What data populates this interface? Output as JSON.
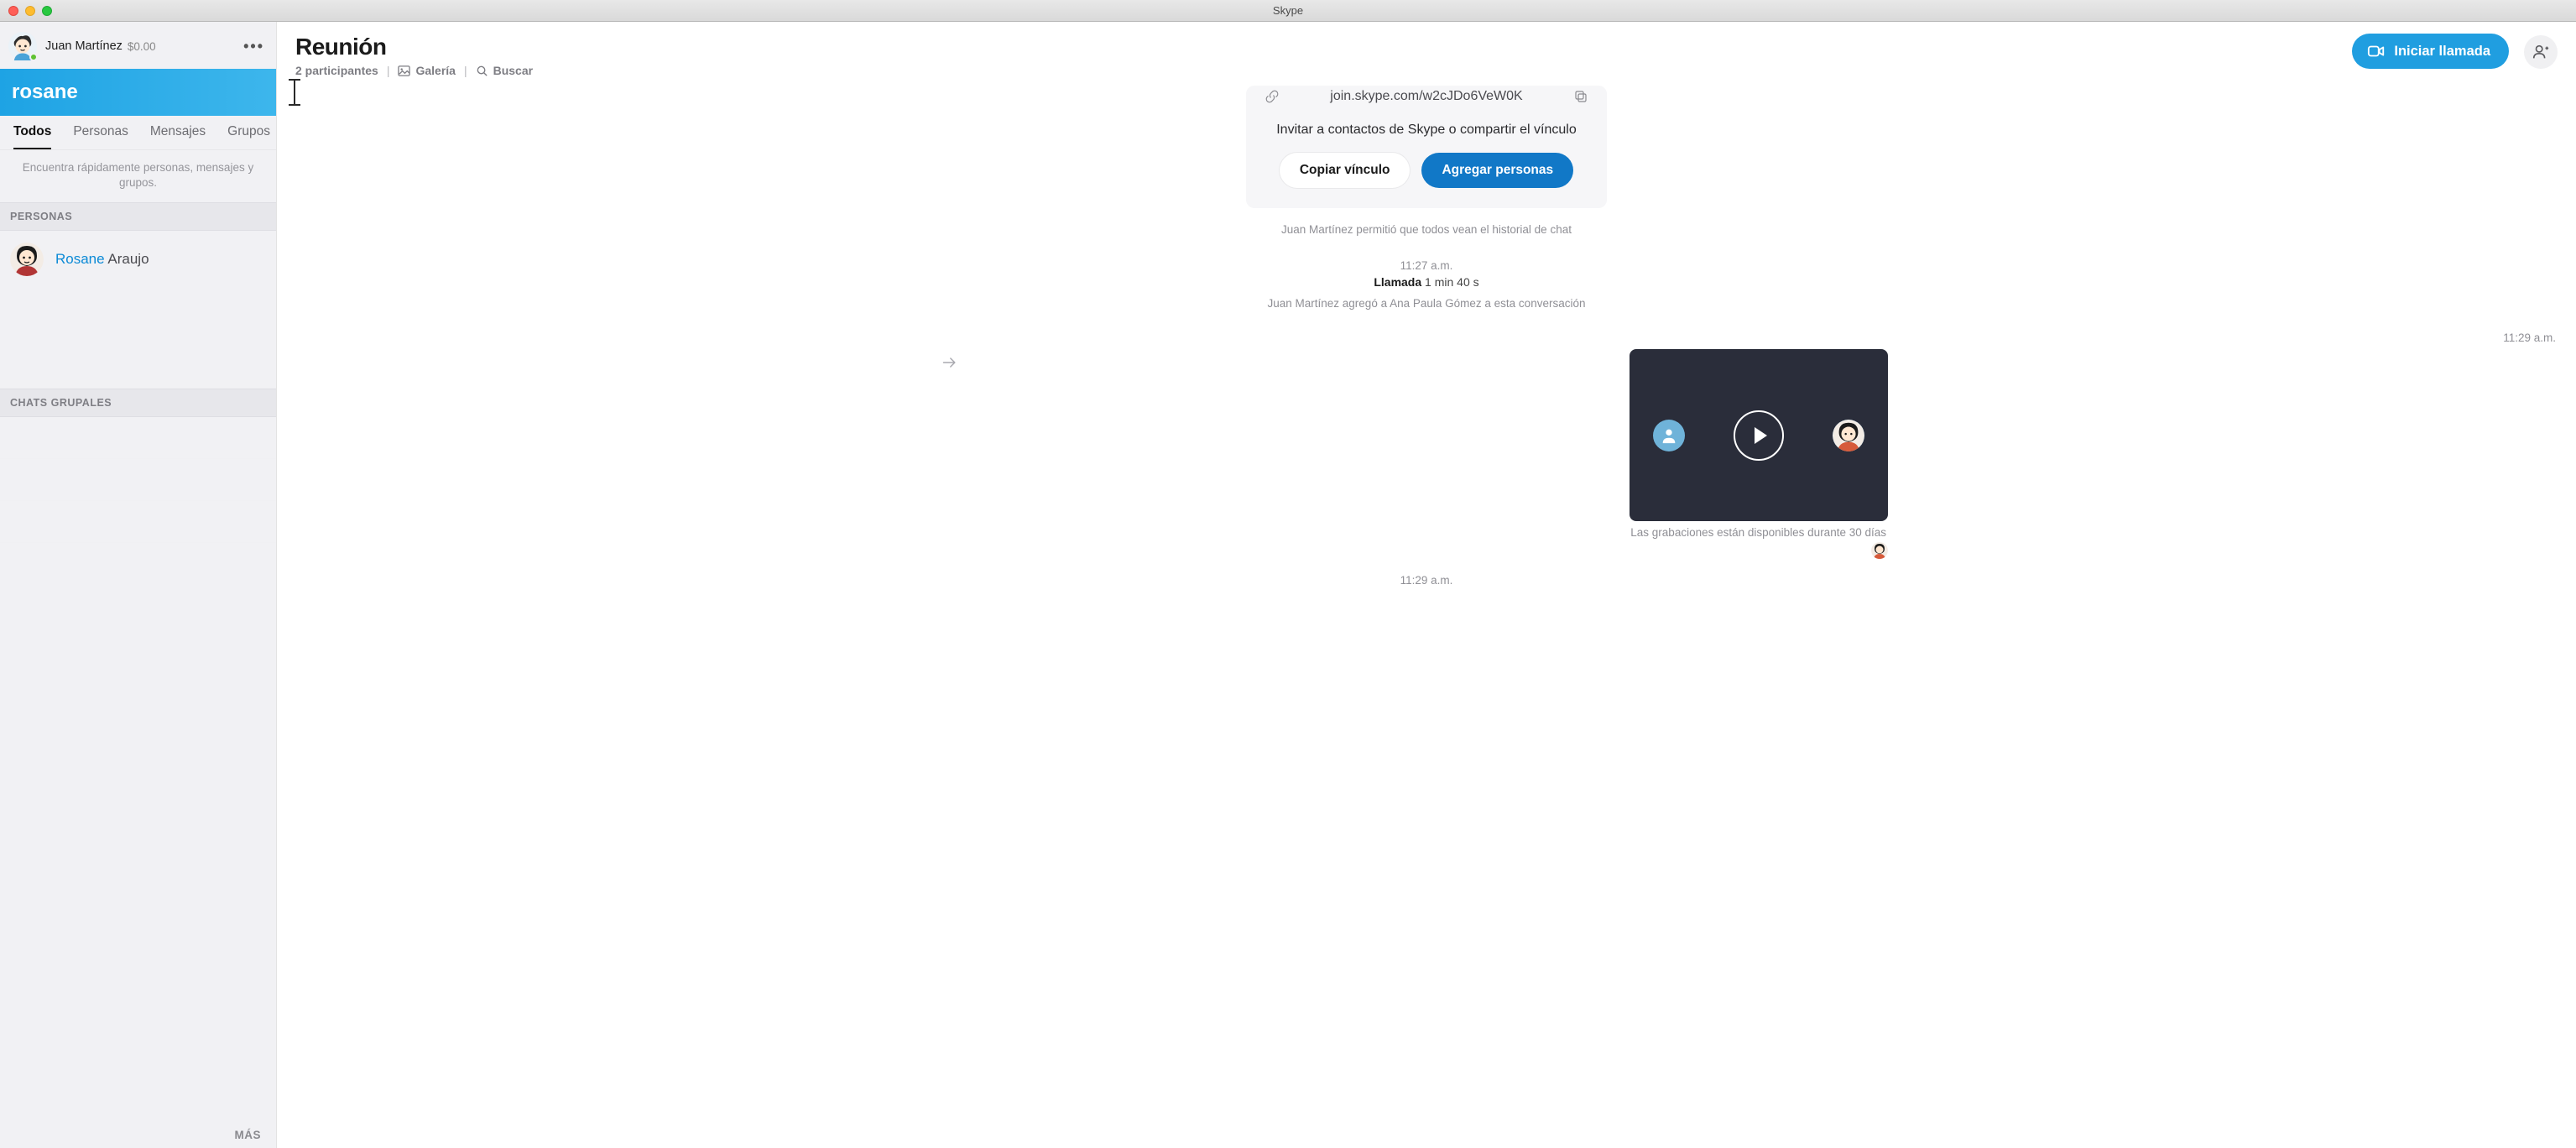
{
  "window": {
    "title": "Skype"
  },
  "profile": {
    "name": "Juan Martínez",
    "balance": "$0.00"
  },
  "search": {
    "value": "rosane",
    "clear_aria": "Clear"
  },
  "tabs": {
    "items": [
      "Todos",
      "Personas",
      "Mensajes",
      "Grupos"
    ],
    "active": 0,
    "hint": "Encuentra rápidamente personas, mensajes y grupos."
  },
  "sections": {
    "people_header": "PERSONAS",
    "groups_header": "CHATS GRUPALES",
    "more": "MÁS"
  },
  "results": {
    "people": [
      {
        "highlight": "Rosane",
        "rest": " Araujo"
      }
    ]
  },
  "chat": {
    "title": "Reunión",
    "participants_label": "2 participantes",
    "gallery_label": "Galería",
    "search_label": "Buscar",
    "call_button": "Iniciar llamada"
  },
  "invite": {
    "link": "join.skype.com/w2cJDo6VeW0K",
    "text": "Invitar a contactos de Skype o compartir el vínculo",
    "copy_button": "Copiar vínculo",
    "add_button": "Agregar personas"
  },
  "timeline": {
    "history_msg": "Juan Martínez permitió que todos vean el historial de chat",
    "time1": "11:27 a.m.",
    "call_word": "Llamada",
    "call_duration": "1 min 40 s",
    "added_msg": "Juan Martínez agregó a Ana Paula Gómez a esta conversación",
    "time2": "11:29 a.m.",
    "recording_note": "Las grabaciones están disponibles durante 30 días",
    "time3": "11:29 a.m."
  }
}
